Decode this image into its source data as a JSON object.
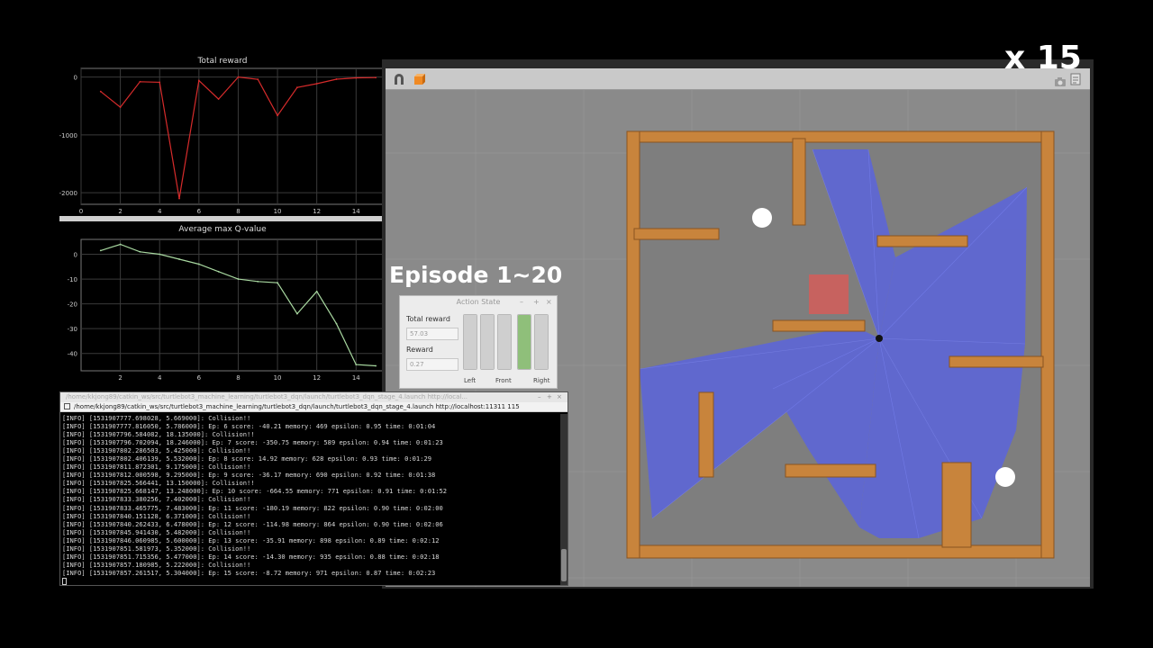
{
  "overlays": {
    "speed_label": "x 15",
    "episode_label": "Episode 1~20"
  },
  "reward_plot": {
    "title": "Total reward",
    "y_ticks": [
      "0",
      "-1000",
      "-2000"
    ],
    "x_ticks": [
      "0",
      "2",
      "4",
      "6",
      "8",
      "10",
      "12",
      "14"
    ],
    "line_color": "#d62b2b"
  },
  "q_plot": {
    "title": "Average max Q-value",
    "y_ticks": [
      "0",
      "-10",
      "-20",
      "-30",
      "-40"
    ],
    "x_ticks": [
      "2",
      "4",
      "6",
      "8",
      "10",
      "12",
      "14"
    ],
    "line_color": "#a8d8a0"
  },
  "chart_data": [
    {
      "type": "line",
      "title": "Total reward",
      "x": [
        1,
        2,
        3,
        4,
        5,
        6,
        7,
        8,
        9,
        10,
        11,
        12,
        13,
        14,
        15
      ],
      "y": [
        -250,
        -520,
        -80,
        -90,
        -2100,
        -60,
        -380,
        0,
        -40,
        -665,
        -180,
        -115,
        -36,
        -14,
        -9
      ],
      "xlim": [
        0,
        15.5
      ],
      "ylim": [
        -2200,
        150
      ],
      "grid": true
    },
    {
      "type": "line",
      "title": "Average max Q-value",
      "x": [
        1,
        2,
        3,
        4,
        5,
        6,
        7,
        8,
        9,
        10,
        11,
        12,
        13,
        14,
        15
      ],
      "y": [
        1.5,
        4.0,
        1.0,
        0.0,
        -2.0,
        -4.0,
        -7.0,
        -10.0,
        -11.0,
        -11.5,
        -24.0,
        -15.0,
        -28.0,
        -44.5,
        -45.0
      ],
      "xlim": [
        0,
        15.5
      ],
      "ylim": [
        -47,
        6
      ],
      "grid": true
    }
  ],
  "action_state": {
    "title": "Action State",
    "controls": [
      "–",
      "+",
      "×"
    ],
    "total_reward_label": "Total reward",
    "total_reward_value": "57.03",
    "reward_label": "Reward",
    "reward_value": "0.27",
    "bars": [
      {
        "label": "Left",
        "level": 1.0,
        "active": false
      },
      {
        "label": "",
        "level": 1.0,
        "active": false
      },
      {
        "label": "Front",
        "level": 1.0,
        "active": false
      },
      {
        "label": "",
        "level": 1.0,
        "active": true
      },
      {
        "label": "Right",
        "level": 1.0,
        "active": false
      }
    ]
  },
  "terminal": {
    "window_title": "/home/kkjong89/catkin_ws/src/turtlebot3_machine_learning/turtlebot3_dqn/launch/turtlebot3_dqn_stage_4.launch http://local...",
    "window_controls": [
      "–",
      "+",
      "×"
    ],
    "tab_title": "/home/kkjong89/catkin_ws/src/turtlebot3_machine_learning/turtlebot3_dqn/launch/turtlebot3_dqn_stage_4.launch http://localhost:11311 115",
    "lines": [
      "[INFO] [1531907777.698028, 5.669000]: Collision!!",
      "[INFO] [1531907777.816050, 5.786000]: Ep: 6 score: -40.21 memory: 469 epsilon: 0.95 time: 0:01:04",
      "[INFO] [1531907796.584082, 18.135000]: Collision!!",
      "[INFO] [1531907796.702094, 18.246000]: Ep: 7 score: -350.75 memory: 589 epsilon: 0.94 time: 0:01:23",
      "[INFO] [1531907802.286503, 5.425000]: Collision!!",
      "[INFO] [1531907802.406139, 5.532000]: Ep: 8 score: 14.92 memory: 628 epsilon: 0.93 time: 0:01:29",
      "[INFO] [1531907811.872301, 9.175000]: Collision!!",
      "[INFO] [1531907812.000598, 9.295000]: Ep: 9 score: -36.17 memory: 690 epsilon: 0.92 time: 0:01:38",
      "[INFO] [1531907825.566441, 13.150000]: Collision!!",
      "[INFO] [1531907825.668147, 13.248000]: Ep: 10 score: -664.55 memory: 771 epsilon: 0.91 time: 0:01:52",
      "[INFO] [1531907833.380256, 7.402000]: Collision!!",
      "[INFO] [1531907833.465775, 7.483000]: Ep: 11 score: -180.19 memory: 822 epsilon: 0.90 time: 0:02:00",
      "[INFO] [1531907840.151128, 6.371000]: Collision!!",
      "[INFO] [1531907840.262433, 6.478000]: Ep: 12 score: -114.98 memory: 864 epsilon: 0.90 time: 0:02:06",
      "[INFO] [1531907845.941430, 5.482000]: Collision!!",
      "[INFO] [1531907846.060985, 5.600000]: Ep: 13 score: -35.91 memory: 898 epsilon: 0.89 time: 0:02:12",
      "[INFO] [1531907851.581973, 5.352000]: Collision!!",
      "[INFO] [1531907851.715356, 5.477000]: Ep: 14 score: -14.30 memory: 935 epsilon: 0.88 time: 0:02:18",
      "[INFO] [1531907857.180985, 5.222000]: Collision!!",
      "[INFO] [1531907857.261517, 5.304000]: Ep: 15 score: -8.72 memory: 971 epsilon: 0.87 time: 0:02:23"
    ]
  },
  "colors": {
    "wall_wood": "#c8843c",
    "laser_blue": "#5560ee",
    "goal_red": "#e05a55",
    "gazebo_floor": "#8a8a8a"
  }
}
